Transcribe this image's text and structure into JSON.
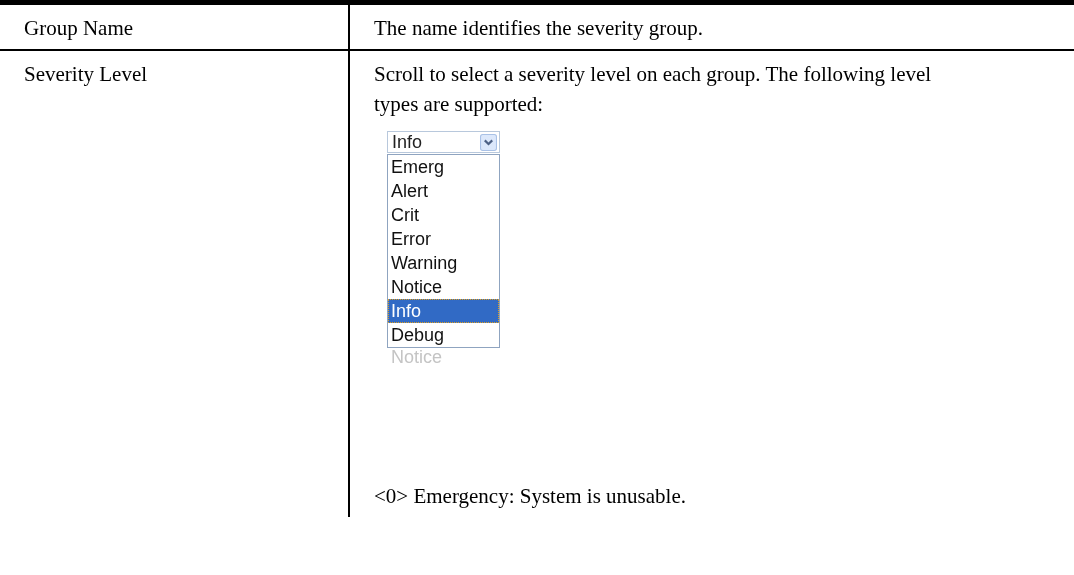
{
  "table": {
    "rows": [
      {
        "parameter": "Group Name",
        "description": [
          "The name identifies the severity group."
        ]
      },
      {
        "parameter": "Severity Level",
        "description": [
          "Scroll to select a severity level on each group. The following level types are supported:"
        ],
        "dropdown": {
          "value": "Info",
          "options": [
            {
              "label": "Emerg",
              "selected": false
            },
            {
              "label": "Alert",
              "selected": false
            },
            {
              "label": "Crit",
              "selected": false
            },
            {
              "label": "Error",
              "selected": false
            },
            {
              "label": "Warning",
              "selected": false
            },
            {
              "label": "Notice",
              "selected": false
            },
            {
              "label": "Info",
              "selected": true
            },
            {
              "label": "Debug",
              "selected": false
            }
          ],
          "behind_value": "Notice"
        },
        "note": "<0> Emergency: System is unusable."
      }
    ]
  }
}
